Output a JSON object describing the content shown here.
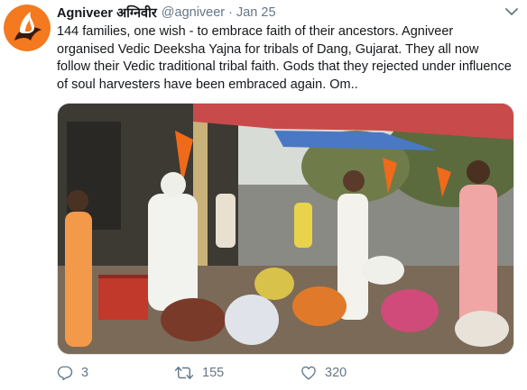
{
  "tweet": {
    "author_name": "Agniveer अग्निवीर",
    "handle": "@agniveer",
    "separator": "·",
    "date": "Jan 25",
    "text": "144 families, one wish - to embrace faith of their ancestors. Agniveer organised Vedic Deeksha Yajna for tribals of Dang, Gujarat. They all now follow their Vedic traditional tribal faith. Gods that they rejected under influence of soul harvesters have been embraced again. Om..",
    "media_icon": "photo"
  },
  "actions": {
    "reply_count": "3",
    "retweet_count": "155",
    "like_count": "320"
  },
  "colors": {
    "accent_orange": "#f4791f",
    "muted_text": "#657786",
    "text": "#14171a"
  },
  "icons": {
    "more": "chevron-down-icon",
    "reply": "reply-icon",
    "retweet": "retweet-icon",
    "like": "heart-icon"
  }
}
